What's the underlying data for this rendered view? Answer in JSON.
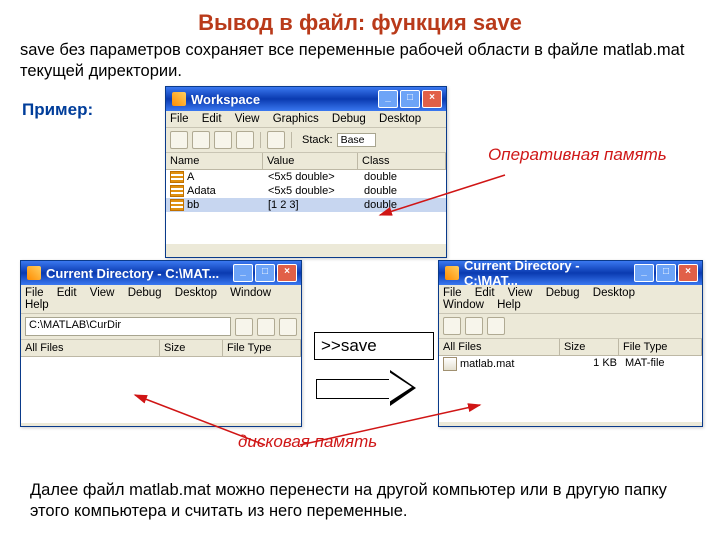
{
  "title": "Вывод в файл: функция save",
  "intro": "save без параметров сохраняет все переменные рабочей области в файле matlab.mat текущей директории.",
  "example_label": "Пример:",
  "ram_label": "Оперативная память",
  "disk_label": "дисковая память",
  "command": ">>save",
  "footer": "Далее файл matlab.mat можно перенести на другой компьютер или в другую папку этого компьютера и считать из него переменные.",
  "workspace": {
    "title": "Workspace",
    "menu": [
      "File",
      "Edit",
      "View",
      "Graphics",
      "Debug",
      "Desktop"
    ],
    "stack_label": "Stack:",
    "stack_value": "Base",
    "columns": [
      "Name",
      "Value",
      "Class"
    ],
    "rows": [
      {
        "name": "A",
        "value": "<5x5 double>",
        "class": "double"
      },
      {
        "name": "Adata",
        "value": "<5x5 double>",
        "class": "double"
      },
      {
        "name": "bb",
        "value": "[1 2 3]",
        "class": "double",
        "selected": true
      }
    ]
  },
  "curdir1": {
    "title": "Current Directory - C:\\MAT...",
    "menu": [
      "File",
      "Edit",
      "View",
      "Debug",
      "Desktop",
      "Window",
      "Help"
    ],
    "path": "C:\\MATLAB\\CurDir",
    "columns": [
      "All Files",
      "Size",
      "File Type"
    ]
  },
  "curdir2": {
    "title": "Current Directory - C:\\MAT...",
    "menu": [
      "File",
      "Edit",
      "View",
      "Debug",
      "Desktop",
      "Window",
      "Help"
    ],
    "columns": [
      "All Files",
      "Size",
      "File Type"
    ],
    "rows": [
      {
        "name": "matlab.mat",
        "size": "1 KB",
        "type": "MAT-file"
      }
    ]
  },
  "win_buttons": {
    "min": "_",
    "max": "□",
    "close": "×"
  }
}
